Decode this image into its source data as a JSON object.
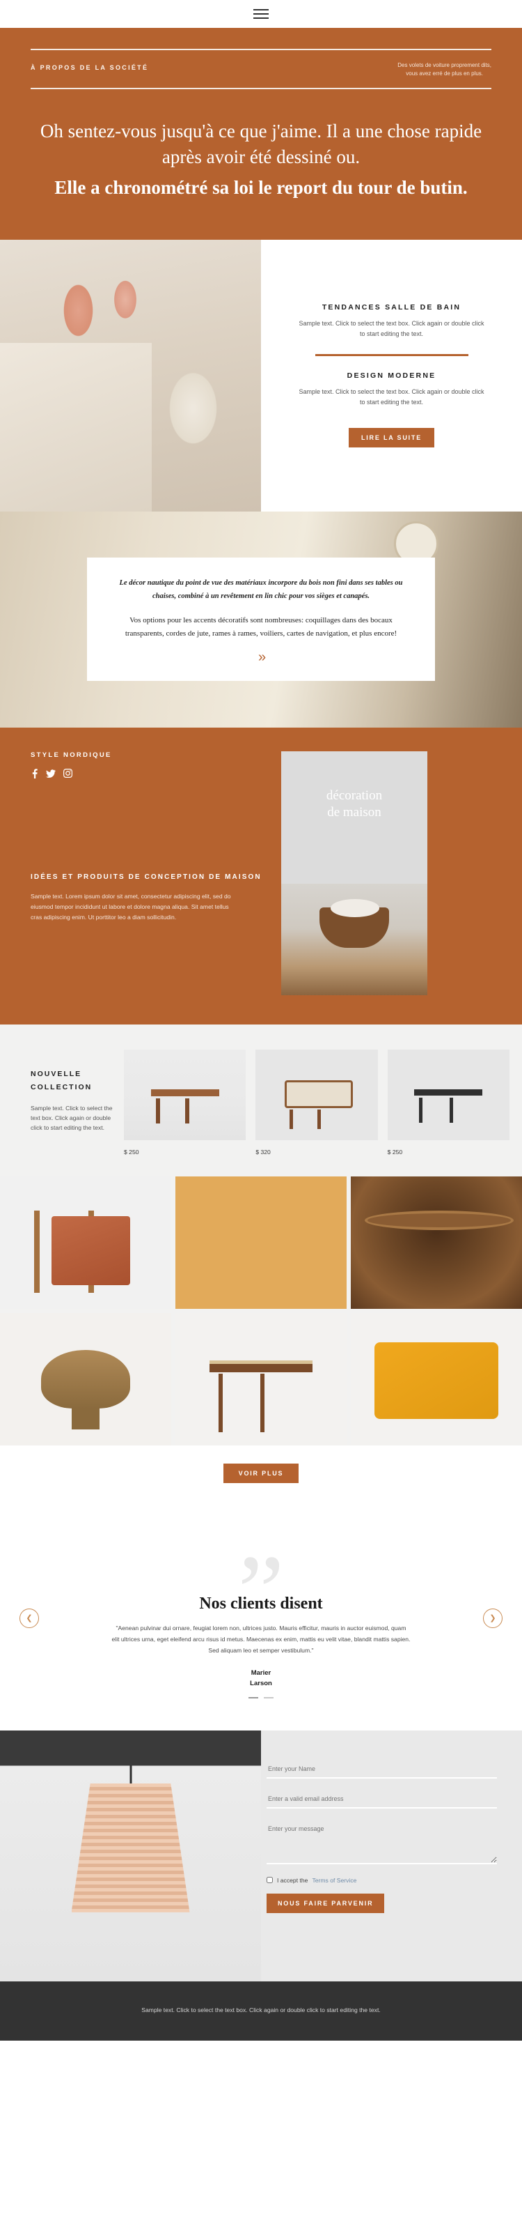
{
  "topbar": {
    "menu_icon": "hamburger-menu-icon"
  },
  "hero": {
    "kicker": "À PROPOS DE LA SOCIÉTÉ",
    "subtitle_line1": "Des volets de voiture proprement dits,",
    "subtitle_line2": "vous avez erré de plus en plus.",
    "title_regular": "Oh sentez-vous jusqu'à ce que j'aime. Il a une chose rapide après avoir été dessiné ou.",
    "title_bold": "Elle a chronométré sa loi le report du tour de butin.",
    "bg_color": "#b5622f"
  },
  "features": {
    "items": [
      {
        "title": "TENDANCES SALLE DE BAIN",
        "body": "Sample text. Click to select the text box. Click again or double click to start editing the text."
      },
      {
        "title": "DESIGN MODERNE",
        "body": "Sample text. Click to select the text box. Click again or double click to start editing the text."
      }
    ],
    "cta": "LIRE LA SUITE"
  },
  "quote": {
    "emphasis": "Le décor nautique du point de vue des matériaux incorpore du bois non fini dans ses tables ou chaises, combiné à un revêtement en lin chic pour vos sièges et canapés.",
    "paragraph": "Vos options pour les accents décoratifs sont nombreuses: coquillages dans des bocaux transparents, cordes de jute, rames à rames, voiliers, cartes de navigation, et plus encore!",
    "arrow_glyph": "»"
  },
  "nordic": {
    "kicker": "STYLE NORDIQUE",
    "socials": [
      "facebook-icon",
      "twitter-icon",
      "instagram-icon"
    ],
    "heading": "IDÉES ET PRODUITS DE CONCEPTION DE MAISON",
    "body": "Sample text. Lorem ipsum dolor sit amet, consectetur adipiscing elit, sed do eiusmod tempor incididunt ut labore et dolore magna aliqua. Sit amet tellus cras adipiscing enim. Ut porttitor leo a diam sollicitudin.",
    "card_title_line1": "décoration",
    "card_title_line2": "de maison"
  },
  "collection": {
    "title": "NOUVELLE COLLECTION",
    "body": "Sample text. Click to select the text box. Click again or double click to start editing the text.",
    "products": [
      {
        "price": "$ 250",
        "image": "wooden-bench-image"
      },
      {
        "price": "$ 320",
        "image": "rattan-lounge-chair-image"
      },
      {
        "price": "$ 250",
        "image": "black-bench-image"
      }
    ]
  },
  "gallery": {
    "items": [
      {
        "image": "chair-with-throw-image"
      },
      {
        "image": "leopard-print-image"
      },
      {
        "image": "rattan-basket-chair-image"
      },
      {
        "image": "woven-pedestal-bowl-image"
      },
      {
        "image": "cane-top-bench-image"
      },
      {
        "image": "yellow-cushion-image"
      }
    ],
    "cta": "VOIR PLUS"
  },
  "testimonials": {
    "title": "Nos clients disent",
    "quote": "\"Aenean pulvinar dui ornare, feugiat lorem non, ultrices justo. Mauris efficitur, mauris in auctor euismod, quam elit ultrices urna, eget eleifend arcu risus id metus. Maecenas ex enim, mattis eu velit vitae, blandit mattis sapien. Sed aliquam leo et semper vestibulum.\"",
    "author_line1": "Marier",
    "author_line2": "Larson",
    "prev_icon": "chevron-left-icon",
    "next_icon": "chevron-right-icon"
  },
  "contact": {
    "name_placeholder": "Enter your Name",
    "email_placeholder": "Enter a valid email address",
    "message_placeholder": "Enter your message",
    "accept_text": "I accept the",
    "terms_link": "Terms of Service",
    "submit": "NOUS FAIRE PARVENIR",
    "image": "rattan-pendant-lamp-image"
  },
  "footer": {
    "text": "Sample text. Click to select the text box. Click again or double click to start editing the text."
  }
}
